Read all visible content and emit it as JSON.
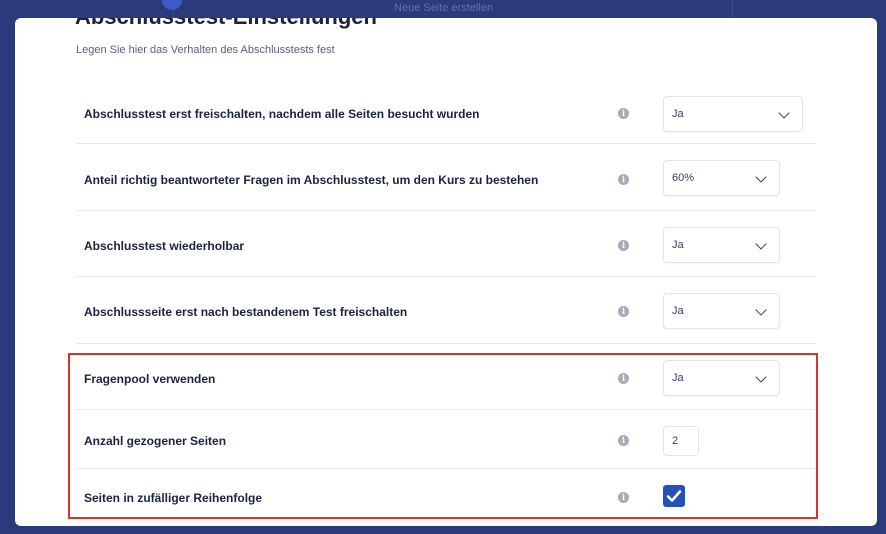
{
  "background": {
    "hint_label": "Neue Seite erstellen"
  },
  "modal": {
    "title": "Abschlusstest-Einstellungen",
    "subtitle": "Legen Sie hier das Verhalten des Abschlusstests fest"
  },
  "settings": [
    {
      "label": "Abschlusstest erst freischalten, nachdem alle Seiten besucht wurden",
      "control": "select",
      "value": "Ja"
    },
    {
      "label": "Anteil richtig beantworteter Fragen im Abschlusstest, um den Kurs zu bestehen",
      "control": "select",
      "value": "60%"
    },
    {
      "label": "Abschlusstest wiederholbar",
      "control": "select",
      "value": "Ja"
    },
    {
      "label": "Abschlussseite erst nach bestandenem Test freischalten",
      "control": "select",
      "value": "Ja"
    },
    {
      "label": "Fragenpool verwenden",
      "control": "select",
      "value": "Ja"
    },
    {
      "label": "Anzahl gezogener Seiten",
      "control": "number",
      "value": "2"
    },
    {
      "label": "Seiten in zufälliger Reihenfolge",
      "control": "checkbox",
      "checked": true
    }
  ],
  "info_icon_glyph": "i",
  "colors": {
    "accent": "#2552b8",
    "highlight": "#d8322c",
    "backdrop": "#2b3a7a"
  },
  "icons": {
    "info": "info-icon",
    "dropdown": "chevron-down-icon",
    "check": "checkmark-icon"
  }
}
